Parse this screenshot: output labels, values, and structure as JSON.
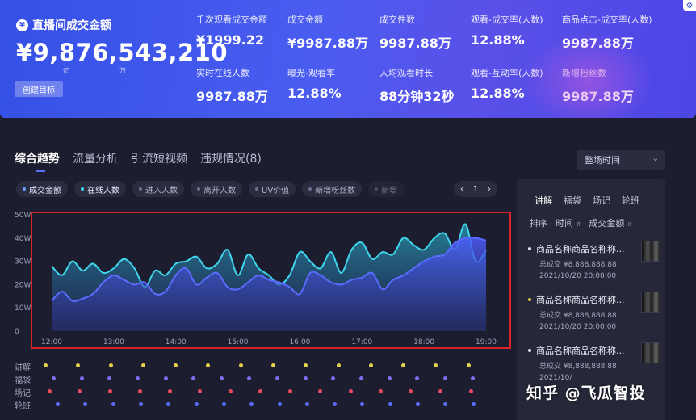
{
  "header": {
    "gmv_label": "直播间成交金额",
    "gmv_icon": "¥",
    "gmv_value": "¥9,876,543,210",
    "unit_yi": "亿",
    "unit_wan": "万",
    "create_button": "创建目标",
    "gear_icon": "⚙",
    "metrics": [
      {
        "label": "千次观看成交金额",
        "value": "¥1999.22"
      },
      {
        "label": "成交金额",
        "value": "¥9987.88万"
      },
      {
        "label": "成交件数",
        "value": "9987.88万"
      },
      {
        "label": "观看-成交率(人数)",
        "value": "12.88%"
      },
      {
        "label": "商品点击-成交率(人数)",
        "value": "9987.88万"
      },
      {
        "label": "实时在线人数",
        "value": "9987.88万"
      },
      {
        "label": "曝光-观看率",
        "value": "12.88%"
      },
      {
        "label": "人均观看时长",
        "value": "88分钟32秒"
      },
      {
        "label": "观看-互动率(人数)",
        "value": "12.88%"
      },
      {
        "label": "新增粉丝数",
        "value": "9987.88万"
      }
    ]
  },
  "tabs": [
    {
      "label": "综合趋势",
      "active": true
    },
    {
      "label": "流量分析",
      "active": false
    },
    {
      "label": "引流短视频",
      "active": false
    },
    {
      "label": "违规情况(8)",
      "active": false
    }
  ],
  "time_select": {
    "value": "整场时间",
    "chevron": "⌄"
  },
  "chips": [
    {
      "label": "成交金额",
      "active": true,
      "color": "#6ea2ff"
    },
    {
      "label": "在线人数",
      "active": true,
      "color": "#3fd6ee"
    },
    {
      "label": "进入人数",
      "active": false
    },
    {
      "label": "离开人数",
      "active": false
    },
    {
      "label": "UV价值",
      "active": false
    },
    {
      "label": "新增粉丝数",
      "active": false
    },
    {
      "label": "新增",
      "active": false
    }
  ],
  "pager": {
    "prev": "‹",
    "page": "1",
    "next": "›"
  },
  "chart_data": {
    "type": "area",
    "title": "",
    "xlabel": "",
    "ylabel": "",
    "x": [
      "12:00",
      "12:10",
      "12:20",
      "12:30",
      "12:40",
      "12:50",
      "13:00",
      "13:10",
      "13:20",
      "13:30",
      "13:40",
      "13:50",
      "14:00",
      "14:10",
      "14:20",
      "14:30",
      "14:40",
      "14:50",
      "15:00",
      "15:10",
      "15:20",
      "15:30",
      "15:40",
      "15:50",
      "16:00",
      "16:10",
      "16:20",
      "16:30",
      "16:40",
      "16:50",
      "17:00",
      "17:10",
      "17:20",
      "17:30",
      "17:40",
      "17:50",
      "18:00",
      "18:10",
      "18:20",
      "18:30",
      "18:40",
      "18:50",
      "19:00"
    ],
    "x_ticks": [
      "12:00",
      "13:00",
      "14:00",
      "15:00",
      "16:00",
      "17:00",
      "18:00",
      "19:00"
    ],
    "y_ticks": [
      "50W",
      "40W",
      "30W",
      "20W",
      "10W",
      "0"
    ],
    "ylim": [
      0,
      50
    ],
    "grid": false,
    "series": [
      {
        "color": "#3fd6ee",
        "values": [
          28,
          24,
          30,
          26,
          29,
          25,
          27,
          31,
          27,
          19,
          26,
          24,
          29,
          30,
          32,
          27,
          29,
          35,
          24,
          33,
          27,
          24,
          20,
          24,
          34,
          30,
          27,
          34,
          25,
          35,
          38,
          31,
          34,
          33,
          40,
          37,
          35,
          40,
          42,
          35,
          46,
          30,
          35
        ]
      },
      {
        "color": "#5a6cff",
        "values": [
          13,
          17,
          13,
          14,
          16,
          21,
          24,
          22,
          20,
          21,
          16,
          17,
          24,
          27,
          20,
          23,
          25,
          19,
          18,
          21,
          24,
          22,
          21,
          19,
          16,
          25,
          24,
          21,
          20,
          22,
          23,
          25,
          18,
          22,
          24,
          27,
          30,
          32,
          33,
          38,
          40,
          40,
          39
        ]
      }
    ]
  },
  "events": [
    {
      "label": "讲解",
      "color": "#e8d14a",
      "count": 14
    },
    {
      "label": "福袋",
      "color": "#7b6ff0",
      "count": 16
    },
    {
      "label": "场记",
      "color": "#e84b5f",
      "count": 15
    },
    {
      "label": "轮班",
      "color": "#5a6cff",
      "count": 16
    }
  ],
  "side": {
    "tabs": [
      "讲解",
      "福袋",
      "场记",
      "轮班"
    ],
    "sort_label": "排序",
    "sort_time": "时间",
    "sort_amount": "成交金额",
    "sort_arrow": "⇵",
    "products": [
      {
        "name": "商品名称商品名称称...",
        "sales": "总成交 ¥8,888,888.88",
        "date": "2021/10/20 20:00:00"
      },
      {
        "name": "商品名称商品名称称...",
        "sales": "总成交 ¥8,888,888.88",
        "date": "2021/10/20 20:00:00"
      },
      {
        "name": "商品名称商品名称称...",
        "sales": "总成交 ¥8,888,888.88",
        "date": "2021/10/"
      }
    ]
  },
  "watermark": "知乎 @飞瓜智投"
}
